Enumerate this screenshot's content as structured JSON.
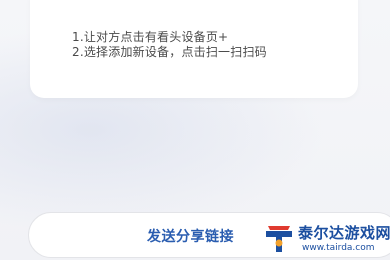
{
  "instructions": {
    "step1": "1.让对方点击有看头设备页+",
    "step2": "2.选择添加新设备，点击扫一扫扫码"
  },
  "share_button": {
    "label": "发送分享链接"
  },
  "watermark": {
    "site_name": "泰尔达游戏网",
    "url": "www.tairda.com",
    "logo_icon": "tairda-logo-icon",
    "colors": {
      "brand_blue": "#1c4fa0",
      "brand_red": "#e03a2f",
      "brand_orange": "#f2a12c"
    }
  },
  "colors": {
    "accent": "#2a5db0",
    "background": "#f3f4f7",
    "card": "#ffffff"
  }
}
